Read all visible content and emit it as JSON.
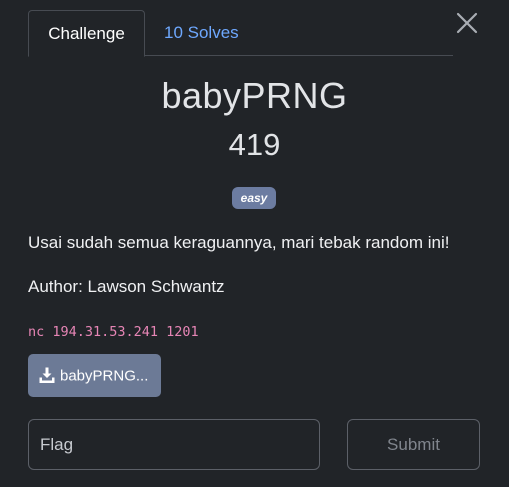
{
  "tabs": {
    "challenge": "Challenge",
    "solves": "10 Solves"
  },
  "challenge": {
    "name": "babyPRNG",
    "points": "419",
    "difficulty": "easy",
    "description": "Usai sudah semua keraguannya, mari tebak random ini!",
    "author": "Author: Lawson Schwantz",
    "connection": "nc 194.31.53.241 1201"
  },
  "files": {
    "download_label": "babyPRNG..."
  },
  "form": {
    "flag_placeholder": "Flag",
    "submit_label": "Submit"
  },
  "icons": {
    "close": "close-icon",
    "download": "download-icon"
  },
  "colors": {
    "background": "#212428",
    "accent_link": "#6ea8fe",
    "badge": "#6c7ca1",
    "code": "#e685b5",
    "file_button": "#6c7a96"
  }
}
